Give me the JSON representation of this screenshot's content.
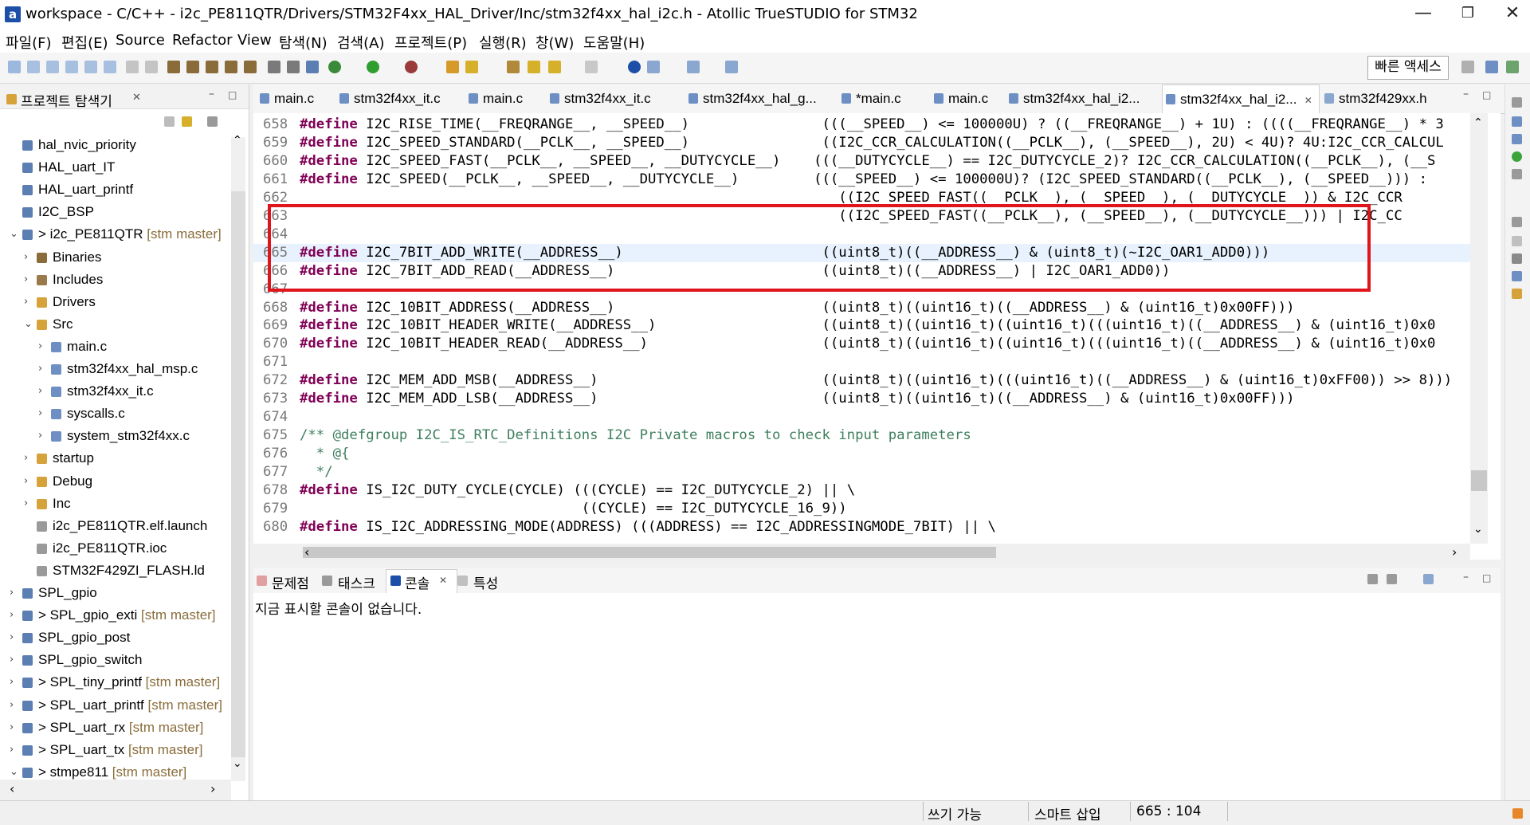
{
  "window": {
    "title": "workspace - C/C++ - i2c_PE811QTR/Drivers/STM32F4xx_HAL_Driver/Inc/stm32f4xx_hal_i2c.h - Atollic TrueSTUDIO for STM32",
    "logo_letter": "a"
  },
  "menu": [
    "파일(F)",
    "편집(E)",
    "Source",
    "Refactor",
    "View",
    "탐색(N)",
    "검색(A)",
    "프로젝트(P)",
    "실행(R)",
    "창(W)",
    "도움말(H)"
  ],
  "toolbar": {
    "quick_access": "빠른 액세스"
  },
  "project_explorer": {
    "title": "프로젝트 탐색기",
    "items": [
      {
        "label": "hal_nvic_priority",
        "branch": ""
      },
      {
        "label": "HAL_uart_IT",
        "branch": ""
      },
      {
        "label": "HAL_uart_printf",
        "branch": ""
      },
      {
        "label": "I2C_BSP",
        "branch": ""
      },
      {
        "label": "> i2c_PE811QTR",
        "branch": "[stm master]"
      },
      {
        "label": "Binaries",
        "branch": ""
      },
      {
        "label": "Includes",
        "branch": ""
      },
      {
        "label": "Drivers",
        "branch": ""
      },
      {
        "label": "Src",
        "branch": ""
      },
      {
        "label": "main.c",
        "branch": ""
      },
      {
        "label": "stm32f4xx_hal_msp.c",
        "branch": ""
      },
      {
        "label": "stm32f4xx_it.c",
        "branch": ""
      },
      {
        "label": "syscalls.c",
        "branch": ""
      },
      {
        "label": "system_stm32f4xx.c",
        "branch": ""
      },
      {
        "label": "startup",
        "branch": ""
      },
      {
        "label": "Debug",
        "branch": ""
      },
      {
        "label": "Inc",
        "branch": ""
      },
      {
        "label": "i2c_PE811QTR.elf.launch",
        "branch": ""
      },
      {
        "label": "i2c_PE811QTR.ioc",
        "branch": ""
      },
      {
        "label": "STM32F429ZI_FLASH.ld",
        "branch": ""
      },
      {
        "label": "SPL_gpio",
        "branch": ""
      },
      {
        "label": "> SPL_gpio_exti",
        "branch": "[stm master]"
      },
      {
        "label": "SPL_gpio_post",
        "branch": ""
      },
      {
        "label": "SPL_gpio_switch",
        "branch": ""
      },
      {
        "label": "> SPL_tiny_printf",
        "branch": "[stm master]"
      },
      {
        "label": "> SPL_uart_printf",
        "branch": "[stm master]"
      },
      {
        "label": "> SPL_uart_rx",
        "branch": "[stm master]"
      },
      {
        "label": "> SPL_uart_tx",
        "branch": "[stm master]"
      },
      {
        "label": "> stmpe811",
        "branch": "[stm master]"
      }
    ]
  },
  "editor_tabs": [
    "main.c",
    "stm32f4xx_it.c",
    "main.c",
    "stm32f4xx_it.c",
    "stm32f4xx_hal_g...",
    "*main.c",
    "main.c",
    "stm32f4xx_hal_i2...",
    "stm32f4xx_hal_i2...",
    "stm32f429xx.h"
  ],
  "code_lines": [
    {
      "n": "658",
      "kw": "#define",
      "text": " I2C_RISE_TIME(__FREQRANGE__, __SPEED__)                (((__SPEED__) <= 100000U) ? ((__FREQRANGE__) + 1U) : ((((__FREQRANGE__) * 3"
    },
    {
      "n": "659",
      "kw": "#define",
      "text": " I2C_SPEED_STANDARD(__PCLK__, __SPEED__)                ((I2C_CCR_CALCULATION((__PCLK__), (__SPEED__), 2U) < 4U)? 4U:I2C_CCR_CALCUL"
    },
    {
      "n": "660",
      "kw": "#define",
      "text": " I2C_SPEED_FAST(__PCLK__, __SPEED__, __DUTYCYCLE__)    (((__DUTYCYCLE__) == I2C_DUTYCYCLE_2)? I2C_CCR_CALCULATION((__PCLK__), (__S"
    },
    {
      "n": "661",
      "kw": "#define",
      "text": " I2C_SPEED(__PCLK__, __SPEED__, __DUTYCYCLE__)         (((__SPEED__) <= 100000U)? (I2C_SPEED_STANDARD((__PCLK__), (__SPEED__))) :"
    },
    {
      "n": "662",
      "kw": "",
      "text": "                                                                 ((I2C_SPEED_FAST((__PCLK__), (__SPEED__), (__DUTYCYCLE__)) & I2C_CCR"
    },
    {
      "n": "663",
      "kw": "",
      "text": "                                                                 ((I2C_SPEED_FAST((__PCLK__), (__SPEED__), (__DUTYCYCLE__))) | I2C_CC"
    },
    {
      "n": "664",
      "kw": "",
      "text": ""
    },
    {
      "n": "665",
      "kw": "#define",
      "text": " I2C_7BIT_ADD_WRITE(__ADDRESS__)                        ((uint8_t)((__ADDRESS__) & (uint8_t)(~I2C_OAR1_ADD0)))"
    },
    {
      "n": "666",
      "kw": "#define",
      "text": " I2C_7BIT_ADD_READ(__ADDRESS__)                         ((uint8_t)((__ADDRESS__) | I2C_OAR1_ADD0))"
    },
    {
      "n": "667",
      "kw": "",
      "text": ""
    },
    {
      "n": "668",
      "kw": "#define",
      "text": " I2C_10BIT_ADDRESS(__ADDRESS__)                         ((uint8_t)((uint16_t)((__ADDRESS__) & (uint16_t)0x00FF)))"
    },
    {
      "n": "669",
      "kw": "#define",
      "text": " I2C_10BIT_HEADER_WRITE(__ADDRESS__)                    ((uint8_t)((uint16_t)((uint16_t)(((uint16_t)((__ADDRESS__) & (uint16_t)0x0"
    },
    {
      "n": "670",
      "kw": "#define",
      "text": " I2C_10BIT_HEADER_READ(__ADDRESS__)                     ((uint8_t)((uint16_t)((uint16_t)(((uint16_t)((__ADDRESS__) & (uint16_t)0x0"
    },
    {
      "n": "671",
      "kw": "",
      "text": ""
    },
    {
      "n": "672",
      "kw": "#define",
      "text": " I2C_MEM_ADD_MSB(__ADDRESS__)                           ((uint8_t)((uint16_t)(((uint16_t)((__ADDRESS__) & (uint16_t)0xFF00)) >> 8)))"
    },
    {
      "n": "673",
      "kw": "#define",
      "text": " I2C_MEM_ADD_LSB(__ADDRESS__)                           ((uint8_t)((uint16_t)((__ADDRESS__) & (uint16_t)0x00FF)))"
    },
    {
      "n": "674",
      "kw": "",
      "text": ""
    },
    {
      "n": "675",
      "kw": "",
      "text": "/** @defgroup I2C_IS_RTC_Definitions I2C Private macros to check input parameters",
      "comment": true
    },
    {
      "n": "676",
      "kw": "",
      "text": "  * @{",
      "comment": true
    },
    {
      "n": "677",
      "kw": "",
      "text": "  */",
      "comment": true
    },
    {
      "n": "678",
      "kw": "#define",
      "text": " IS_I2C_DUTY_CYCLE(CYCLE) (((CYCLE) == I2C_DUTYCYCLE_2) || \\"
    },
    {
      "n": "679",
      "kw": "",
      "text": "                                  ((CYCLE) == I2C_DUTYCYCLE_16_9))"
    },
    {
      "n": "680",
      "kw": "#define",
      "text": " IS_I2C_ADDRESSING_MODE(ADDRESS) (((ADDRESS) == I2C_ADDRESSINGMODE_7BIT) || \\"
    }
  ],
  "console": {
    "tabs": [
      "문제점",
      "태스크",
      "콘솔",
      "특성"
    ],
    "message": "지금 표시할 콘솔이 없습니다."
  },
  "status": {
    "writable": "쓰기 가능",
    "insert_mode": "스마트 삽입",
    "position": "665 : 104"
  }
}
